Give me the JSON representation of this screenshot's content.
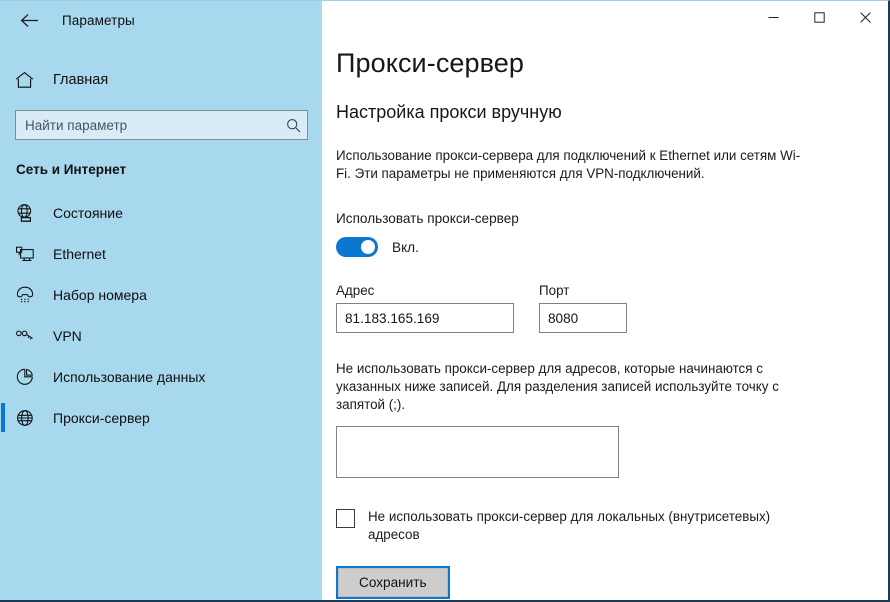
{
  "window": {
    "app_title": "Параметры",
    "back_icon": "back-arrow-icon",
    "controls": {
      "minimize": "−",
      "maximize": "□",
      "close": "✕"
    }
  },
  "sidebar": {
    "home": {
      "label": "Главная",
      "icon": "home-icon"
    },
    "search": {
      "placeholder": "Найти параметр",
      "value": "",
      "icon": "search-icon"
    },
    "section_title": "Сеть и Интернет",
    "items": [
      {
        "label": "Состояние",
        "icon": "status-globe-icon",
        "selected": false
      },
      {
        "label": "Ethernet",
        "icon": "ethernet-icon",
        "selected": false
      },
      {
        "label": "Набор номера",
        "icon": "dialup-phone-icon",
        "selected": false
      },
      {
        "label": "VPN",
        "icon": "vpn-key-icon",
        "selected": false
      },
      {
        "label": "Использование данных",
        "icon": "data-usage-pie-icon",
        "selected": false
      },
      {
        "label": "Прокси-сервер",
        "icon": "proxy-globe-icon",
        "selected": true
      }
    ]
  },
  "main": {
    "page_title": "Прокси-сервер",
    "section_heading": "Настройка прокси вручную",
    "description": "Использование прокси-сервера для подключений к Ethernet или сетям Wi-Fi. Эти параметры не применяются для VPN-подключений.",
    "toggle": {
      "label": "Использовать прокси-сервер",
      "state_text": "Вкл.",
      "checked": true
    },
    "address": {
      "label": "Адрес",
      "value": "81.183.165.169"
    },
    "port": {
      "label": "Порт",
      "value": "8080"
    },
    "bypass": {
      "description": "Не использовать прокси-сервер для адресов, которые начинаются с указанных ниже записей. Для разделения записей используйте точку с запятой (;).",
      "value": "",
      "placeholder": ""
    },
    "local_checkbox": {
      "label": "Не использовать прокси-сервер для локальных (внутрисетевых) адресов",
      "checked": false
    },
    "save_button": "Сохранить"
  },
  "colors": {
    "sidebar_bg": "#a8d8ee",
    "accent": "#0b78d0",
    "window_border": "#1b3a57",
    "search_bg": "#d7ecf7",
    "button_bg": "#cdcdcd"
  }
}
